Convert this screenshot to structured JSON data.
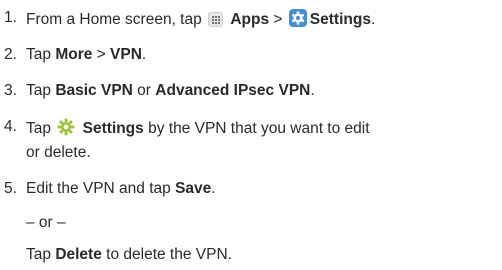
{
  "steps": [
    {
      "number": "1.",
      "pre": "From a Home screen, tap",
      "apps": "Apps",
      "sep": ">",
      "settings": "Settings",
      "end": "."
    },
    {
      "number": "2.",
      "pre": "Tap",
      "more": "More",
      "sep": ">",
      "vpn": "VPN",
      "end": "."
    },
    {
      "number": "3.",
      "pre": "Tap",
      "basic": "Basic VPN",
      "or": "or",
      "advanced": "Advanced IPsec VPN",
      "end": "."
    },
    {
      "number": "4.",
      "pre": "Tap",
      "settings": "Settings",
      "post": "by the VPN that you want to edit",
      "line2": "or delete."
    },
    {
      "number": "5.",
      "pre": "Edit the VPN and tap",
      "save": "Save",
      "end": ".",
      "or_line": "– or –",
      "alt_pre": "Tap",
      "delete": "Delete",
      "alt_post": "to delete the VPN."
    }
  ],
  "icons": {
    "apps": "apps-grid-icon",
    "settings": "settings-app-icon",
    "gear": "gear-icon"
  },
  "colors": {
    "text": "#2a2a2a",
    "settings_icon_bg": "#3e8fd8",
    "gear_icon": "#9fc43a"
  }
}
